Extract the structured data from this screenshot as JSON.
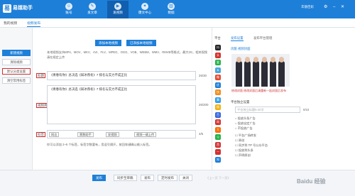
{
  "app": {
    "title": "易媒助手",
    "logo_glyph": "易"
  },
  "nav": [
    {
      "label": "账号",
      "icon": "user-icon",
      "glyph": "☺"
    },
    {
      "label": "发文章",
      "icon": "edit-icon",
      "glyph": "✎"
    },
    {
      "label": "发视频",
      "icon": "play-icon",
      "glyph": "▶"
    },
    {
      "label": "爆文中心",
      "icon": "flame-icon",
      "glyph": "✦"
    },
    {
      "label": "数据",
      "icon": "chart-icon",
      "glyph": "▥"
    }
  ],
  "titlebar": {
    "right_label": "华丽佳彩",
    "icons": "⚙ – ✕"
  },
  "tabs": {
    "my_videos": "我的视频",
    "publish": "视频发布"
  },
  "left": {
    "new_video": "新建视频",
    "reset": "清除视频",
    "default_settings": "默认分类设置",
    "clear_tags": "清空常用标签"
  },
  "main": {
    "add_local": "添加本地视频",
    "added_local": "已添加本地视频",
    "formats": "本地视频支持MP4、MOV、MKV、AVI、FLV、MPEG、OGG、VOB、WEBM、WMV、RMVB等格式，最大2G，相关视频请在规定上传",
    "title_label": "标题",
    "title_value": "《青春有你》总决选《知冰燕冬》7 排名与实力不成正比",
    "title_count": "26/30",
    "desc_label": "视频简介",
    "desc_value": "《青春有你》总决选《知冰燕冬》7 排名与实力不成正比",
    "desc_count": "26/200",
    "tags_label": "标签",
    "tags": [
      "网达",
      "票数助手",
      "发视频",
      "视频一键上传"
    ],
    "tags_count": "4/5",
    "tag_hint": "你可以添加 2~5 个标签，标签字数要有，用逗号隔开，按回车键确认输入标签。"
  },
  "right": {
    "platforms_head": "平台",
    "tab_settings": "发布设置",
    "tab_manager": "发布平台管理",
    "platform_name": "优酷",
    "platform_heading": "优酷 视频封面",
    "cover_caption": "修改封面 修改封面后请重新一起封面后发布",
    "cover_label": "平台独立设置",
    "cover_placeholder": "平台独立标题5-20字",
    "cover_count": "0/10",
    "options": [
      "投放头条广告",
      "投放自定广告",
      "不投放广告",
      "平台广场转发",
      "原创",
      "同步到 TP 号公众平台",
      "投放到头条",
      "声明原创"
    ],
    "platform_icons": [
      {
        "name": "douyin-icon",
        "glyph": "抖",
        "color": "#222222"
      },
      {
        "name": "toutiao-icon",
        "glyph": "头",
        "color": "#d23030"
      },
      {
        "name": "iqiyi-icon",
        "glyph": "爱",
        "color": "#25b24a"
      },
      {
        "name": "bilibili-icon",
        "glyph": "B",
        "color": "#4aa7dd"
      },
      {
        "name": "weibo-icon",
        "glyph": "微",
        "color": "#e2492f"
      },
      {
        "name": "youku-icon",
        "glyph": "优",
        "color": "#1e7fd8"
      },
      {
        "name": "kuaishou-icon",
        "glyph": "快",
        "color": "#f28a1a"
      },
      {
        "name": "tencent-icon",
        "glyph": "腾",
        "color": "#2a9cf0"
      },
      {
        "name": "sohu-icon",
        "glyph": "搜",
        "color": "#f0b012"
      },
      {
        "name": "baidu-icon",
        "glyph": "百",
        "color": "#3366dd"
      },
      {
        "name": "wangyi-icon",
        "glyph": "网",
        "color": "#d23030"
      },
      {
        "name": "dayu-icon",
        "glyph": "大",
        "color": "#ff6a00"
      },
      {
        "name": "qq-icon",
        "glyph": "Q",
        "color": "#25b24a"
      },
      {
        "name": "xigua-icon",
        "glyph": "西",
        "color": "#d23030"
      },
      {
        "name": "yidian-icon",
        "glyph": "一",
        "color": "#d23030"
      },
      {
        "name": "zhihu-icon",
        "glyph": "知",
        "color": "#1e7fd8"
      }
    ]
  },
  "actions": {
    "publish": "发布",
    "sync_draft": "同步至草稿",
    "release": "发布",
    "timed": "定时发布",
    "close": "关闭",
    "pager": "《上一页  下一页》"
  },
  "watermark": "Baidu 经验"
}
